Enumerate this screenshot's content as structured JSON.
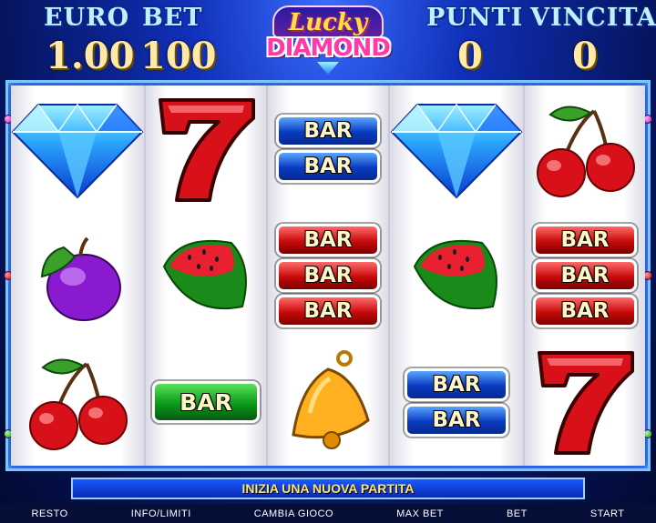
{
  "header": {
    "euro_label": "EURO",
    "bet_label": "BET",
    "euro_value": "1.00",
    "bet_value": "100",
    "punti_label": "PUNTI",
    "vincita_label": "VINCITA",
    "punti_value": "0",
    "vincita_value": "0",
    "logo_top": "Lucky",
    "logo_bottom": "DIAMOND"
  },
  "reels": [
    [
      "diamond-icon",
      "plum-icon",
      "cherry-icon"
    ],
    [
      "seven-icon",
      "watermelon-icon",
      "bar-single-green"
    ],
    [
      "bar-double-blue",
      "bar-triple-red",
      "bell-icon"
    ],
    [
      "diamond-icon",
      "watermelon-icon",
      "bar-double-blue"
    ],
    [
      "cherry-icon",
      "bar-triple-red",
      "seven-icon"
    ]
  ],
  "bar_label": "BAR",
  "message": "INIZIA UNA NUOVA PARTITA",
  "buttons": {
    "resto": "RESTO",
    "info": "INFO/LIMITI",
    "cambia": "CAMBIA GIOCO",
    "maxbet": "MAX BET",
    "bet": "BET",
    "start": "START"
  },
  "colors": {
    "background": "#1030b8",
    "reel_bg": "#ffffff",
    "message_text": "#ffe66a",
    "header_value": "#ffe9a8"
  }
}
